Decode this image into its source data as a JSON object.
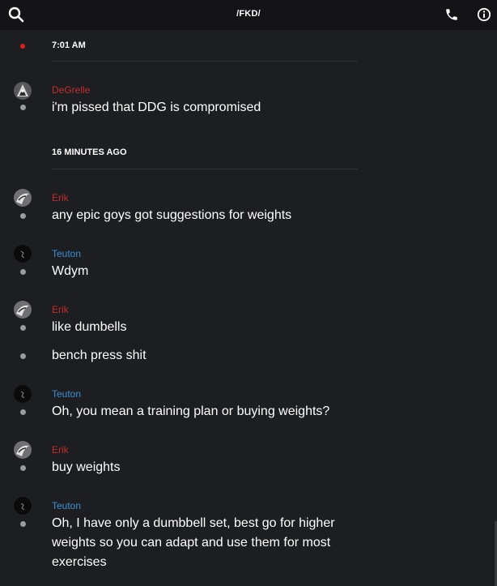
{
  "header": {
    "title": "/FKD/",
    "left_icon": "search-icon",
    "right_icons": [
      "phone-icon",
      "info-icon"
    ]
  },
  "dividers": [
    {
      "label": "7:01 AM"
    },
    {
      "label": "16 MINUTES AGO"
    }
  ],
  "messages": [
    {
      "author": "DeGrelle",
      "author_color": "#c62b2b",
      "text": "i'm pissed that DDG is compromised"
    },
    {
      "author": "Erik",
      "author_color": "#c62b2b",
      "text": "any epic goys got suggestions for weights"
    },
    {
      "author": "Teuton",
      "author_color": "#3b8fd0",
      "text": "Wdym"
    },
    {
      "author": "Erik",
      "author_color": "#c62b2b",
      "text": "like dumbells"
    },
    {
      "author": "",
      "text": "bench press shit"
    },
    {
      "author": "Teuton",
      "author_color": "#3b8fd0",
      "text": "Oh, you mean a training plan or buying weights?"
    },
    {
      "author": "Erik",
      "author_color": "#c62b2b",
      "text": "buy weights"
    },
    {
      "author": "Teuton",
      "author_color": "#3b8fd0",
      "text": "Oh, I have only a dumbbell set, best go for higher weights so you can adapt and use them for most exercises"
    }
  ]
}
